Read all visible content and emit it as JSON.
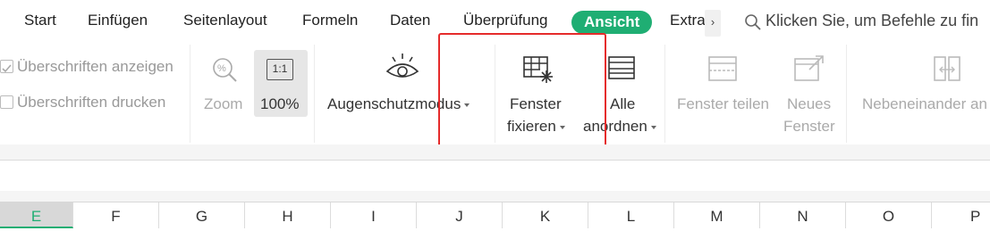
{
  "menu": {
    "tabs": [
      "Start",
      "Einfügen",
      "Seitenlayout",
      "Formeln",
      "Daten",
      "Überprüfung",
      "Ansicht",
      "Extra"
    ],
    "active_tab": "Ansicht",
    "more_glyph": "›",
    "search_placeholder": "Klicken Sie, um Befehle zu fin"
  },
  "ribbon": {
    "show_headings": "Überschriften anzeigen",
    "print_headings": "Überschriften drucken",
    "zoom": "Zoom",
    "zoom_100": "100%",
    "zoom_100_icon_text": "1:1",
    "eye_protection": "Augenschutzmodus",
    "freeze_line1": "Fenster",
    "freeze_line2": "fixieren",
    "arrange_line1": "Alle",
    "arrange_line2": "anordnen",
    "split": "Fenster teilen",
    "new_line1": "Neues",
    "new_line2": "Fenster",
    "side_by_side": "Nebeneinander an"
  },
  "columns": [
    "E",
    "F",
    "G",
    "H",
    "I",
    "J",
    "K",
    "L",
    "M",
    "N",
    "O",
    "P"
  ],
  "selected_column": "E",
  "colors": {
    "accent": "#1fae73",
    "highlight_border": "#e52b2b"
  }
}
